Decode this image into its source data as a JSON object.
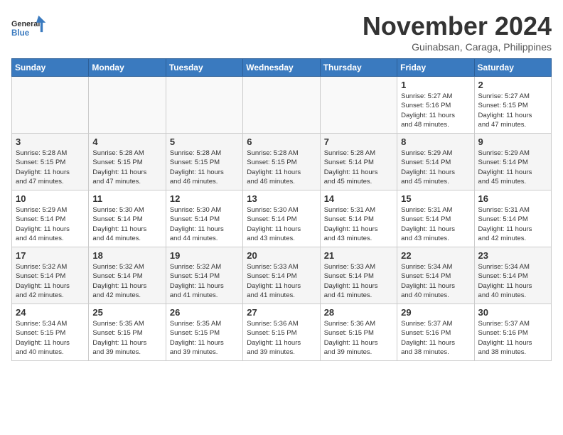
{
  "header": {
    "logo_line1": "General",
    "logo_line2": "Blue",
    "month": "November 2024",
    "location": "Guinabsan, Caraga, Philippines"
  },
  "weekdays": [
    "Sunday",
    "Monday",
    "Tuesday",
    "Wednesday",
    "Thursday",
    "Friday",
    "Saturday"
  ],
  "weeks": [
    [
      {
        "day": "",
        "info": ""
      },
      {
        "day": "",
        "info": ""
      },
      {
        "day": "",
        "info": ""
      },
      {
        "day": "",
        "info": ""
      },
      {
        "day": "",
        "info": ""
      },
      {
        "day": "1",
        "info": "Sunrise: 5:27 AM\nSunset: 5:16 PM\nDaylight: 11 hours\nand 48 minutes."
      },
      {
        "day": "2",
        "info": "Sunrise: 5:27 AM\nSunset: 5:15 PM\nDaylight: 11 hours\nand 47 minutes."
      }
    ],
    [
      {
        "day": "3",
        "info": "Sunrise: 5:28 AM\nSunset: 5:15 PM\nDaylight: 11 hours\nand 47 minutes."
      },
      {
        "day": "4",
        "info": "Sunrise: 5:28 AM\nSunset: 5:15 PM\nDaylight: 11 hours\nand 47 minutes."
      },
      {
        "day": "5",
        "info": "Sunrise: 5:28 AM\nSunset: 5:15 PM\nDaylight: 11 hours\nand 46 minutes."
      },
      {
        "day": "6",
        "info": "Sunrise: 5:28 AM\nSunset: 5:15 PM\nDaylight: 11 hours\nand 46 minutes."
      },
      {
        "day": "7",
        "info": "Sunrise: 5:28 AM\nSunset: 5:14 PM\nDaylight: 11 hours\nand 45 minutes."
      },
      {
        "day": "8",
        "info": "Sunrise: 5:29 AM\nSunset: 5:14 PM\nDaylight: 11 hours\nand 45 minutes."
      },
      {
        "day": "9",
        "info": "Sunrise: 5:29 AM\nSunset: 5:14 PM\nDaylight: 11 hours\nand 45 minutes."
      }
    ],
    [
      {
        "day": "10",
        "info": "Sunrise: 5:29 AM\nSunset: 5:14 PM\nDaylight: 11 hours\nand 44 minutes."
      },
      {
        "day": "11",
        "info": "Sunrise: 5:30 AM\nSunset: 5:14 PM\nDaylight: 11 hours\nand 44 minutes."
      },
      {
        "day": "12",
        "info": "Sunrise: 5:30 AM\nSunset: 5:14 PM\nDaylight: 11 hours\nand 44 minutes."
      },
      {
        "day": "13",
        "info": "Sunrise: 5:30 AM\nSunset: 5:14 PM\nDaylight: 11 hours\nand 43 minutes."
      },
      {
        "day": "14",
        "info": "Sunrise: 5:31 AM\nSunset: 5:14 PM\nDaylight: 11 hours\nand 43 minutes."
      },
      {
        "day": "15",
        "info": "Sunrise: 5:31 AM\nSunset: 5:14 PM\nDaylight: 11 hours\nand 43 minutes."
      },
      {
        "day": "16",
        "info": "Sunrise: 5:31 AM\nSunset: 5:14 PM\nDaylight: 11 hours\nand 42 minutes."
      }
    ],
    [
      {
        "day": "17",
        "info": "Sunrise: 5:32 AM\nSunset: 5:14 PM\nDaylight: 11 hours\nand 42 minutes."
      },
      {
        "day": "18",
        "info": "Sunrise: 5:32 AM\nSunset: 5:14 PM\nDaylight: 11 hours\nand 42 minutes."
      },
      {
        "day": "19",
        "info": "Sunrise: 5:32 AM\nSunset: 5:14 PM\nDaylight: 11 hours\nand 41 minutes."
      },
      {
        "day": "20",
        "info": "Sunrise: 5:33 AM\nSunset: 5:14 PM\nDaylight: 11 hours\nand 41 minutes."
      },
      {
        "day": "21",
        "info": "Sunrise: 5:33 AM\nSunset: 5:14 PM\nDaylight: 11 hours\nand 41 minutes."
      },
      {
        "day": "22",
        "info": "Sunrise: 5:34 AM\nSunset: 5:14 PM\nDaylight: 11 hours\nand 40 minutes."
      },
      {
        "day": "23",
        "info": "Sunrise: 5:34 AM\nSunset: 5:14 PM\nDaylight: 11 hours\nand 40 minutes."
      }
    ],
    [
      {
        "day": "24",
        "info": "Sunrise: 5:34 AM\nSunset: 5:15 PM\nDaylight: 11 hours\nand 40 minutes."
      },
      {
        "day": "25",
        "info": "Sunrise: 5:35 AM\nSunset: 5:15 PM\nDaylight: 11 hours\nand 39 minutes."
      },
      {
        "day": "26",
        "info": "Sunrise: 5:35 AM\nSunset: 5:15 PM\nDaylight: 11 hours\nand 39 minutes."
      },
      {
        "day": "27",
        "info": "Sunrise: 5:36 AM\nSunset: 5:15 PM\nDaylight: 11 hours\nand 39 minutes."
      },
      {
        "day": "28",
        "info": "Sunrise: 5:36 AM\nSunset: 5:15 PM\nDaylight: 11 hours\nand 39 minutes."
      },
      {
        "day": "29",
        "info": "Sunrise: 5:37 AM\nSunset: 5:16 PM\nDaylight: 11 hours\nand 38 minutes."
      },
      {
        "day": "30",
        "info": "Sunrise: 5:37 AM\nSunset: 5:16 PM\nDaylight: 11 hours\nand 38 minutes."
      }
    ]
  ]
}
